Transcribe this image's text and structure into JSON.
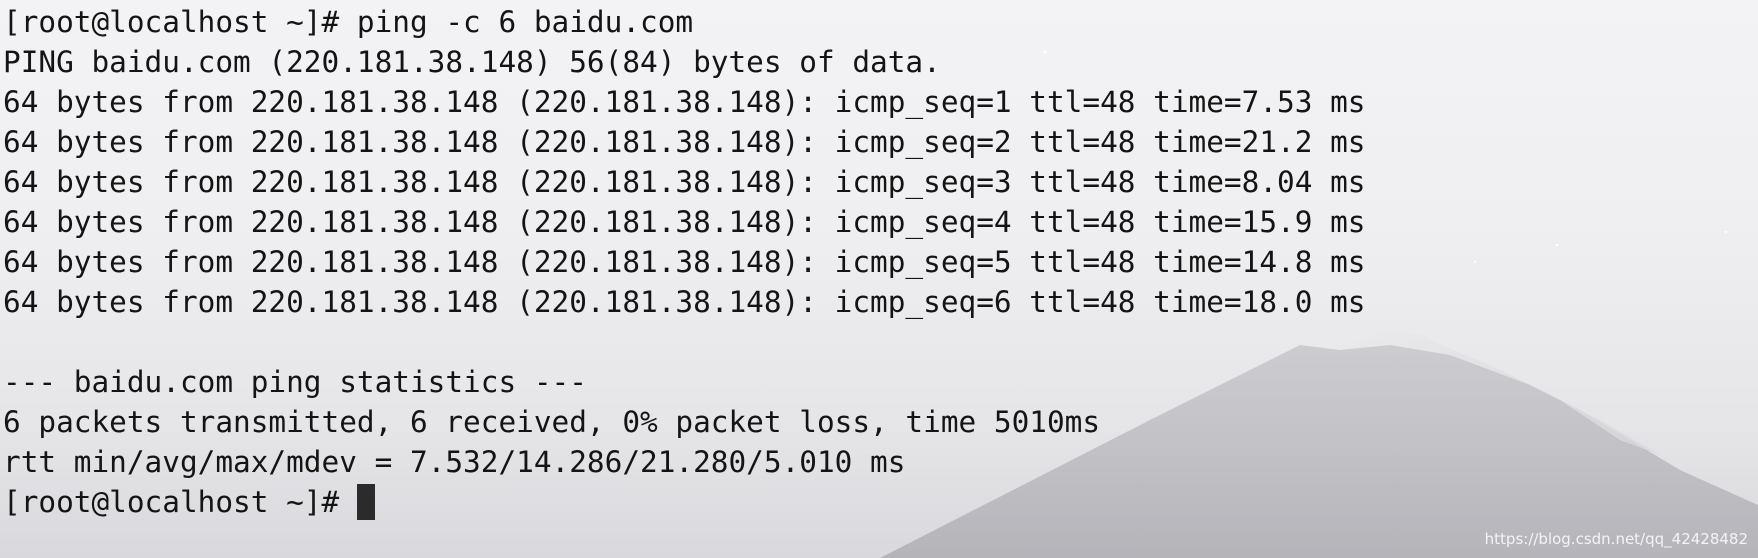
{
  "terminal": {
    "lines": [
      "[root@localhost ~]# ping -c 6 baidu.com",
      "PING baidu.com (220.181.38.148) 56(84) bytes of data.",
      "64 bytes from 220.181.38.148 (220.181.38.148): icmp_seq=1 ttl=48 time=7.53 ms",
      "64 bytes from 220.181.38.148 (220.181.38.148): icmp_seq=2 ttl=48 time=21.2 ms",
      "64 bytes from 220.181.38.148 (220.181.38.148): icmp_seq=3 ttl=48 time=8.04 ms",
      "64 bytes from 220.181.38.148 (220.181.38.148): icmp_seq=4 ttl=48 time=15.9 ms",
      "64 bytes from 220.181.38.148 (220.181.38.148): icmp_seq=5 ttl=48 time=14.8 ms",
      "64 bytes from 220.181.38.148 (220.181.38.148): icmp_seq=6 ttl=48 time=18.0 ms",
      "",
      "--- baidu.com ping statistics ---",
      "6 packets transmitted, 6 received, 0% packet loss, time 5010ms",
      "rtt min/avg/max/mdev = 7.532/14.286/21.280/5.010 ms"
    ],
    "prompt": "[root@localhost ~]# "
  },
  "watermark": "https://blog.csdn.net/qq_42428482",
  "colors": {
    "text": "#141414",
    "cursor": "#2b2b2b",
    "background": "#efeff1",
    "mountain": "#b9b9be"
  }
}
